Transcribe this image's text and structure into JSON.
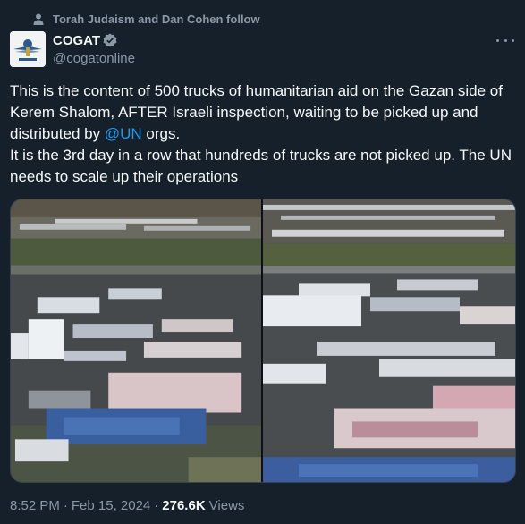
{
  "social_context": {
    "text": "Torah Judaism and Dan Cohen follow",
    "icon": "person-icon"
  },
  "author": {
    "display_name": "COGAT",
    "handle": "@cogatonline",
    "verified": true,
    "verified_color": "#8b98a5",
    "avatar_icon": "cogat-logo"
  },
  "tweet": {
    "text_before_mention": "This is the content of 500 trucks of humanitarian aid on the Gazan side of Kerem Shalom, AFTER Israeli inspection, waiting to be picked up and distributed by ",
    "mention": "@UN",
    "text_after_mention": " orgs.\nIt is the 3rd day in a row that hundreds of trucks are not picked up. The UN needs to scale up their operations"
  },
  "media": {
    "images": [
      "aerial-aid-pallets-left",
      "aerial-aid-pallets-right"
    ]
  },
  "meta": {
    "time": "8:52 PM",
    "separator": "·",
    "date": "Feb 15, 2024",
    "views_count": "276.6K",
    "views_label": "Views"
  },
  "colors": {
    "background": "#15202b",
    "text": "#f7f9f9",
    "muted": "#8b98a5",
    "link": "#1d9bf0"
  }
}
